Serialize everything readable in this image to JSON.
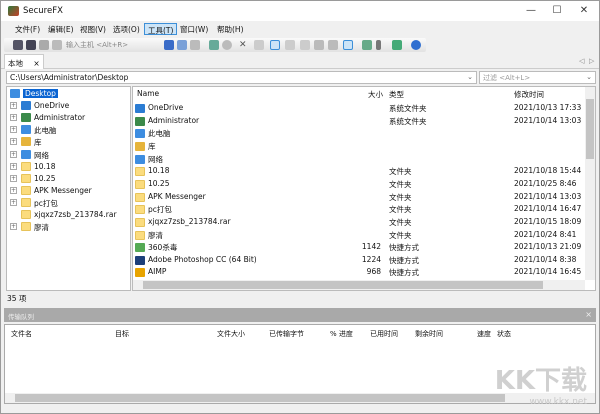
{
  "window": {
    "title": "SecureFX",
    "min": "—",
    "max": "☐",
    "close": "✕"
  },
  "menu": [
    "文件(F)",
    "编辑(E)",
    "视图(V)",
    "选项(O)",
    "工具(T)",
    "窗口(W)",
    "帮助(H)"
  ],
  "toolbar": {
    "host_placeholder": "输入主机 <Alt+R>"
  },
  "tab": {
    "label": "本地",
    "close": "×",
    "nav_left": "◁",
    "nav_right": "▷"
  },
  "path": {
    "value": "C:\\Users\\Administrator\\Desktop",
    "filter_placeholder": "过滤 <Alt+L>"
  },
  "tree": [
    {
      "label": "Desktop",
      "selected": true
    },
    {
      "label": "OneDrive"
    },
    {
      "label": "Administrator"
    },
    {
      "label": "此电脑"
    },
    {
      "label": "库"
    },
    {
      "label": "网络"
    },
    {
      "label": "10.18"
    },
    {
      "label": "10.25"
    },
    {
      "label": "APK Messenger"
    },
    {
      "label": "pc打包"
    },
    {
      "label": "xjqxz7zsb_213784.rar"
    },
    {
      "label": "廖清"
    }
  ],
  "list": {
    "headers": {
      "name": "Name",
      "size": "大小",
      "type": "类型",
      "date": "修改时间"
    },
    "rows": [
      {
        "name": "OneDrive",
        "size": "",
        "type": "系统文件夹",
        "date": "2021/10/13 17:33",
        "icon": "cloud"
      },
      {
        "name": "Administrator",
        "size": "",
        "type": "系统文件夹",
        "date": "2021/10/14 13:03",
        "icon": "user"
      },
      {
        "name": "此电脑",
        "size": "",
        "type": "",
        "date": "",
        "icon": "pc"
      },
      {
        "name": "库",
        "size": "",
        "type": "",
        "date": "",
        "icon": "lib"
      },
      {
        "name": "网络",
        "size": "",
        "type": "",
        "date": "",
        "icon": "net"
      },
      {
        "name": "10.18",
        "size": "",
        "type": "文件夹",
        "date": "2021/10/18 15:44",
        "icon": "folder"
      },
      {
        "name": "10.25",
        "size": "",
        "type": "文件夹",
        "date": "2021/10/25 8:46",
        "icon": "folder"
      },
      {
        "name": "APK Messenger",
        "size": "",
        "type": "文件夹",
        "date": "2021/10/14 13:03",
        "icon": "folder"
      },
      {
        "name": "pc打包",
        "size": "",
        "type": "文件夹",
        "date": "2021/10/14 16:47",
        "icon": "folder"
      },
      {
        "name": "xjqxz7zsb_213784.rar",
        "size": "",
        "type": "文件夹",
        "date": "2021/10/15 18:09",
        "icon": "folder"
      },
      {
        "name": "廖清",
        "size": "",
        "type": "文件夹",
        "date": "2021/10/24 8:41",
        "icon": "folder"
      },
      {
        "name": "360杀毒",
        "size": "1142",
        "type": "快捷方式",
        "date": "2021/10/13 21:09",
        "icon": "360"
      },
      {
        "name": "Adobe Photoshop CC (64 Bit)",
        "size": "1224",
        "type": "快捷方式",
        "date": "2021/10/14 8:38",
        "icon": "ps"
      },
      {
        "name": "AIMP",
        "size": "968",
        "type": "快捷方式",
        "date": "2021/10/14 16:45",
        "icon": "aimp"
      }
    ]
  },
  "status": "35 项",
  "queue": {
    "title": "传输队列",
    "close": "×",
    "columns": [
      "文件名",
      "目标",
      "文件大小",
      "已传输字节",
      "% 进度",
      "已用时间",
      "剩余时间",
      "速度",
      "状态"
    ]
  },
  "watermark": {
    "big": "KK下载",
    "url": "www.kkx.net"
  }
}
